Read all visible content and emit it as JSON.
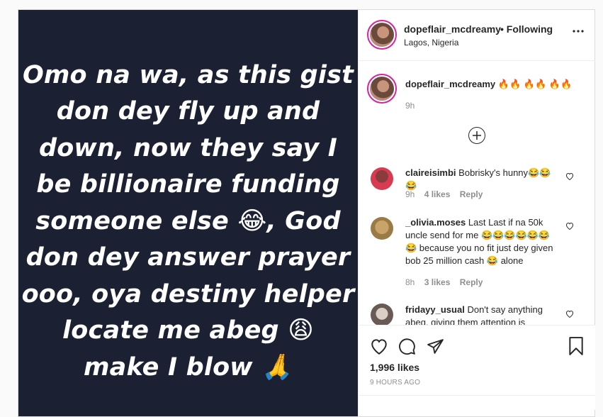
{
  "post": {
    "image_text": "Omo na wa, as this gist don dey fly up and down, now they say I be billionaire funding someone else 😂, God don dey answer prayer ooo, oya destiny helper locate me abeg 😩 make I blow 🙏"
  },
  "header": {
    "username": "dopeflair_mcdreamy",
    "follow_status": "• Following",
    "location": "Lagos, Nigeria",
    "more_icon": "more-horizontal-icon"
  },
  "caption": {
    "username": "dopeflair_mcdreamy",
    "text": "🔥🔥 🔥🔥 🔥🔥",
    "time": "9h"
  },
  "load_more_icon": "plus-circle-icon",
  "comments": [
    {
      "username": "claireisimbi",
      "text": "Bobrisky's hunny😂😂😂",
      "time": "9h",
      "likes": "4 likes",
      "reply": "Reply"
    },
    {
      "username": "_olivia.moses",
      "text": "Last Last if na 50k uncle send for me 😂😂😂😂😂😂😂 because you no fit just dey given bob 25 million cash 😂 alone",
      "time": "8h",
      "likes": "3 likes",
      "reply": "Reply"
    },
    {
      "username": "fridayy_usual",
      "text": "Don't say anything abeg, giving them attention is",
      "time": "",
      "likes": "",
      "reply": ""
    }
  ],
  "actions": {
    "like_icon": "heart-icon",
    "comment_icon": "comment-icon",
    "share_icon": "paper-plane-icon",
    "save_icon": "bookmark-icon",
    "likes_count": "1,996 likes",
    "posted_ago": "9 HOURS AGO"
  }
}
